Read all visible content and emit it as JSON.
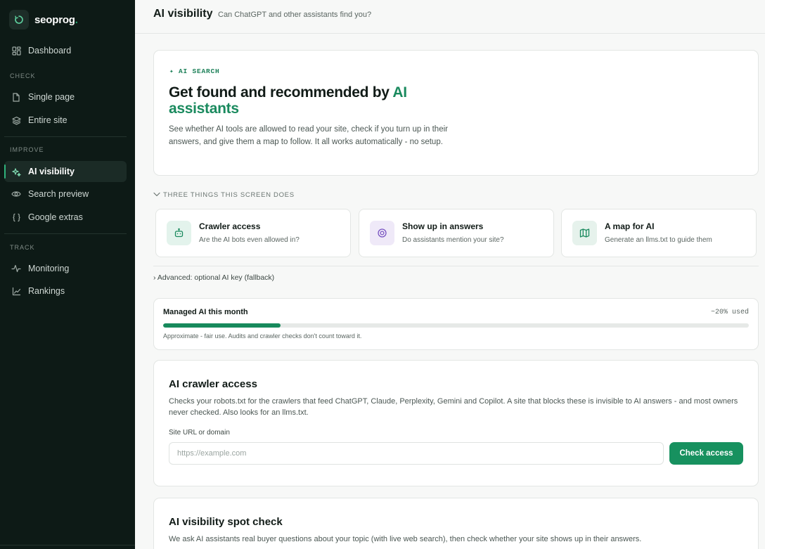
{
  "brand": {
    "name": "seoprog",
    "dot": "."
  },
  "sidebar": {
    "dashboard": "Dashboard",
    "sections": {
      "check": "CHECK",
      "improve": "IMPROVE",
      "track": "TRACK"
    },
    "check_items": [
      "Single page",
      "Entire site"
    ],
    "improve_items": [
      "AI visibility",
      "Search preview",
      "Google extras"
    ],
    "track_items": [
      "Monitoring",
      "Rankings"
    ],
    "active": "AI visibility"
  },
  "header": {
    "title": "AI visibility",
    "subtitle": "Can ChatGPT and other assistants find you?"
  },
  "hero": {
    "eyebrow": "✦ AI SEARCH",
    "title_plain": "Get found and recommended by ",
    "title_highlight": "AI assistants",
    "description": "See whether AI tools are allowed to read your site, check if you turn up in their answers, and give them a map to follow. It all works automatically - no setup."
  },
  "explainer": {
    "toggle_label": "THREE THINGS THIS SCREEN DOES",
    "features": [
      {
        "title": "Crawler access",
        "desc": "Are the AI bots even allowed in?"
      },
      {
        "title": "Show up in answers",
        "desc": "Do assistants mention your site?"
      },
      {
        "title": "A map for AI",
        "desc": "Generate an llms.txt to guide them"
      }
    ]
  },
  "advanced": {
    "label": "› Advanced: optional AI key (fallback)"
  },
  "usage": {
    "title": "Managed AI this month",
    "value_label": "~20% used",
    "fraction": 0.2,
    "note": "Approximate - fair use. Audits and crawler checks don't count toward it."
  },
  "crawler_access": {
    "title": "AI crawler access",
    "description": "Checks your robots.txt for the crawlers that feed ChatGPT, Claude, Perplexity, Gemini and Copilot. A site that blocks these is invisible to AI answers - and most owners never checked. Also looks for an llms.txt.",
    "field_label": "Site URL or domain",
    "placeholder": "https://example.com",
    "value": "",
    "button": "Check access"
  },
  "spot_check": {
    "title": "AI visibility spot check",
    "description": "We ask AI assistants real buyer questions about your topic (with live web search), then check whether your site shows up in their answers."
  },
  "colors": {
    "accent": "#178a5c",
    "sidebar_bg": "#0d1a16",
    "feature_crawler_bg": "#e3f3ec",
    "feature_answers_bg": "#efe9f8",
    "feature_map_bg": "#e6f2ec"
  }
}
